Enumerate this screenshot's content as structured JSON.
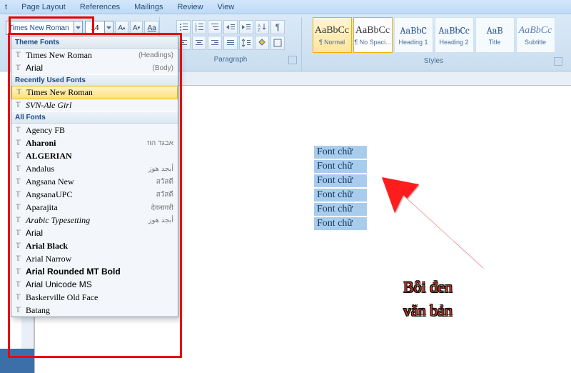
{
  "menubar": [
    "t",
    "Page Layout",
    "References",
    "Mailings",
    "Review",
    "View"
  ],
  "font": {
    "name": "Times New Roman",
    "size": "14"
  },
  "groups": {
    "paragraph": "Paragraph",
    "styles": "Styles"
  },
  "style_items": [
    {
      "preview": "AaBbCc",
      "name": "¶ Normal",
      "cls": "sel"
    },
    {
      "preview": "AaBbCc",
      "name": "¶ No Spaci...",
      "cls": "sel2"
    },
    {
      "preview": "AaBbC",
      "name": "Heading 1",
      "cls": "",
      "blue": true
    },
    {
      "preview": "AaBbCc",
      "name": "Heading 2",
      "cls": "",
      "blue": true
    },
    {
      "preview": "AaB",
      "name": "Title",
      "cls": "",
      "blue": true
    },
    {
      "preview": "AaBbCc",
      "name": "Subtitle",
      "cls": "",
      "it": true
    }
  ],
  "dropdown": {
    "theme_hdr": "Theme Fonts",
    "theme": [
      {
        "name": "Times New Roman",
        "role": "(Headings)",
        "fam": "Times New Roman"
      },
      {
        "name": "Arial",
        "role": "(Body)",
        "fam": "Arial"
      }
    ],
    "recent_hdr": "Recently Used Fonts",
    "recent": [
      {
        "name": "Times New Roman",
        "fam": "Times New Roman",
        "hov": true
      },
      {
        "name": "SVN-Ale Girl",
        "fam": "cursive",
        "style": "italic"
      }
    ],
    "all_hdr": "All Fonts",
    "all": [
      {
        "name": "Agency FB",
        "fam": "Arial Narrow",
        "sample": ""
      },
      {
        "name": "Aharoni",
        "fam": "Arial Black",
        "sample": "אבגד הוז",
        "bold": true
      },
      {
        "name": "ALGERIAN",
        "fam": "serif",
        "sample": "",
        "bold": true,
        "sc": true
      },
      {
        "name": "Andalus",
        "fam": "serif",
        "sample": "أبجد هوز"
      },
      {
        "name": "Angsana New",
        "fam": "serif",
        "sample": "สวัสดี"
      },
      {
        "name": "AngsanaUPC",
        "fam": "serif",
        "sample": "สวัสดี"
      },
      {
        "name": "Aparajita",
        "fam": "serif",
        "sample": "देवनागरी"
      },
      {
        "name": "Arabic Typesetting",
        "fam": "serif",
        "sample": "أبجد هوز",
        "it": true
      },
      {
        "name": "Arial",
        "fam": "Arial",
        "sample": ""
      },
      {
        "name": "Arial Black",
        "fam": "Arial Black",
        "sample": "",
        "bold": true
      },
      {
        "name": "Arial Narrow",
        "fam": "Arial Narrow",
        "sample": ""
      },
      {
        "name": "Arial Rounded MT Bold",
        "fam": "Arial",
        "sample": "",
        "bold": true
      },
      {
        "name": "Arial Unicode MS",
        "fam": "Arial",
        "sample": ""
      },
      {
        "name": "Baskerville Old Face",
        "fam": "Georgia",
        "sample": ""
      },
      {
        "name": "Batang",
        "fam": "serif",
        "sample": ""
      }
    ]
  },
  "doc_lines": [
    "Font chữ",
    "Font chữ",
    "Font chữ",
    "Font chữ",
    "Font chữ",
    "Font chữ"
  ],
  "annotation": {
    "l1": "Bôi đen",
    "l2": "văn bản"
  }
}
